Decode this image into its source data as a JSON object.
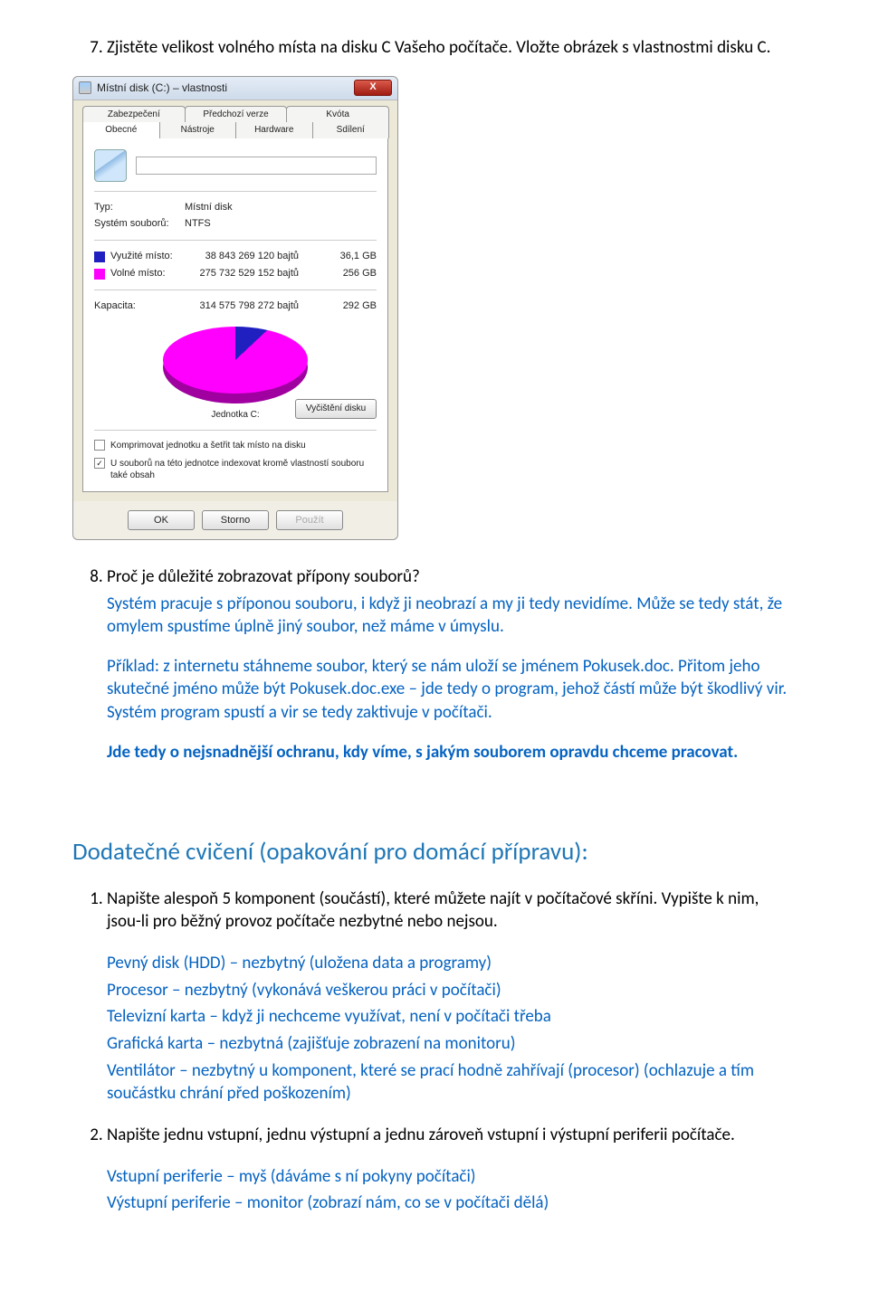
{
  "q7": {
    "number": "7.",
    "text": "Zjistěte velikost volného místa na disku C Vašeho počítače. Vložte obrázek s vlastnostmi disku C."
  },
  "dialog": {
    "title": "Místní disk (C:) – vlastnosti",
    "close": "X",
    "tabs_top": [
      "Zabezpečení",
      "Předchozí verze",
      "Kvóta"
    ],
    "tabs_bottom": [
      "Obecné",
      "Nástroje",
      "Hardware",
      "Sdílení"
    ],
    "typ_label": "Typ:",
    "typ_value": "Místní disk",
    "fs_label": "Systém souborů:",
    "fs_value": "NTFS",
    "used_label": "Využité místo:",
    "used_bytes": "38 843 269 120 bajtů",
    "used_gb": "36,1 GB",
    "free_label": "Volné místo:",
    "free_bytes": "275 732 529 152 bajtů",
    "free_gb": "256 GB",
    "cap_label": "Kapacita:",
    "cap_bytes": "314 575 798 272 bajtů",
    "cap_gb": "292 GB",
    "unit": "Jednotka C:",
    "cleanup": "Vyčištění disku",
    "chk1": "Komprimovat jednotku a šetřit tak místo na disku",
    "chk2": "U souborů na této jednotce indexovat kromě vlastností souboru také obsah",
    "chk2_checked": "✓",
    "btn_ok": "OK",
    "btn_cancel": "Storno",
    "btn_apply": "Použít"
  },
  "q8": {
    "number": "8.",
    "text": "Proč je důležité zobrazovat přípony souborů?",
    "ans1": "Systém pracuje s příponou souboru, i když ji neobrazí a my ji tedy nevidíme. Může se tedy stát, že omylem spustíme úplně jiný soubor, než máme v úmyslu.",
    "ans2": "Příklad: z internetu stáhneme soubor, který se nám uloží se jménem Pokusek.doc. Přitom jeho skutečné jméno může být Pokusek.doc.exe – jde tedy o program, jehož částí může být škodlivý vir. Systém program spustí a vir se tedy zaktivuje v počítači.",
    "ans3": "Jde tedy o nejsnadnější ochranu, kdy víme, s jakým souborem opravdu chceme pracovat."
  },
  "extras_heading": "Dodatečné cvičení (opakování pro domácí přípravu):",
  "e1": {
    "q": "Napište alespoň 5 komponent (součástí), které můžete najít v počítačové skříni. Vypište k nim, jsou-li pro běžný provoz počítače nezbytné nebo nejsou.",
    "a": [
      "Pevný disk (HDD) – nezbytný (uložena data a programy)",
      "Procesor – nezbytný (vykonává veškerou práci v počítači)",
      "Televizní karta – když ji nechceme využívat, není v počítači třeba",
      "Grafická karta – nezbytná (zajišťuje zobrazení na monitoru)",
      "Ventilátor – nezbytný u komponent, které se prací hodně zahřívají (procesor) (ochlazuje a tím součástku chrání před poškozením)"
    ]
  },
  "e2": {
    "q": "Napište jednu vstupní, jednu výstupní a jednu zároveň vstupní i výstupní periferii počítače.",
    "a": [
      "Vstupní periferie – myš (dáváme s ní pokyny počítači)",
      "Výstupní periferie – monitor (zobrazí nám, co se v počítači dělá)"
    ]
  }
}
